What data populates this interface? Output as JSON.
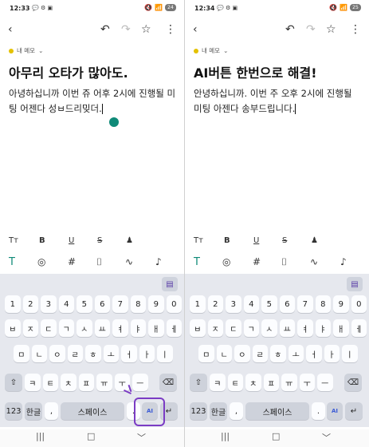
{
  "category": "내 메모",
  "before": {
    "time": "12:33",
    "battery": "24",
    "title": "아무리 오타가 많아도.",
    "body": "아녕하십니까 이번 쥬 어후 2시에 진행될 미팅 어젠다 성ㅂ드리밎더."
  },
  "after": {
    "time": "12:34",
    "battery": "25",
    "title": "AI버튼 한번으로 해결!",
    "body": "안녕하십니까. 이번 주 오후 2시에 진행될 미팅 아젠다 송부드립니다."
  },
  "icons": {
    "status": [
      "chat-icon",
      "settings-icon",
      "doc-icon"
    ],
    "toolbar": [
      "back-icon",
      "undo-icon",
      "redo-icon",
      "star-icon",
      "more-icon"
    ],
    "format": [
      "text-size-icon",
      "bold-icon",
      "underline-icon",
      "strike-icon",
      "text-color-icon"
    ],
    "tools": [
      "text-mode-icon",
      "check-icon",
      "hash-icon",
      "camera-icon",
      "draw-icon",
      "mic-icon"
    ]
  },
  "keyboard": {
    "row1": [
      "1",
      "2",
      "3",
      "4",
      "5",
      "6",
      "7",
      "8",
      "9",
      "0"
    ],
    "row2": [
      "ㅂ",
      "ㅈ",
      "ㄷ",
      "ㄱ",
      "ㅅ",
      "ㅛ",
      "ㅕ",
      "ㅑ",
      "ㅐ",
      "ㅔ"
    ],
    "row3": [
      "ㅁ",
      "ㄴ",
      "ㅇ",
      "ㄹ",
      "ㅎ",
      "ㅗ",
      "ㅓ",
      "ㅏ",
      "ㅣ"
    ],
    "row4": [
      "ㅋ",
      "ㅌ",
      "ㅊ",
      "ㅍ",
      "ㅠ",
      "ㅜ",
      "ㅡ"
    ],
    "shift": "⇧",
    "backspace": "⌫",
    "numbers": "123",
    "lang": "한글",
    "comma": ",",
    "space": "스페이스",
    "period": ".",
    "ai": "AI",
    "enter": "↵"
  },
  "nav": [
    "|||",
    "□",
    "﹀"
  ],
  "colors": {
    "accent": "#6c3ab4",
    "brand": "#e4c100",
    "handle": "#0f8a78"
  }
}
